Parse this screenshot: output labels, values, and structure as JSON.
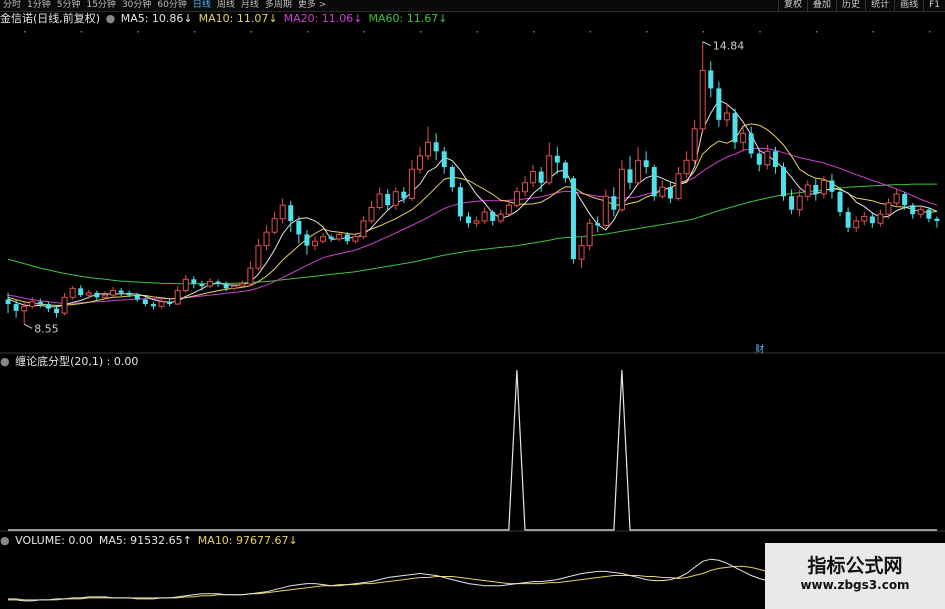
{
  "toolbar": {
    "periods": [
      "分时",
      "1分钟",
      "5分钟",
      "15分钟",
      "30分钟",
      "60分钟",
      "日线",
      "周线",
      "月线",
      "多周期",
      "更多 >"
    ],
    "active_period": "日线",
    "right_buttons": [
      "复权",
      "叠加",
      "历史",
      "统计",
      "画线",
      "F1"
    ]
  },
  "main_panel": {
    "title": "金信诺(日线,前复权)",
    "ma_labels": [
      {
        "text": "MA5: 10.86",
        "arrow": "↓",
        "color": "#e6e6e6"
      },
      {
        "text": "MA10: 11.07",
        "arrow": "↓",
        "color": "#e6d35a"
      },
      {
        "text": "MA20: 11.06",
        "arrow": "↓",
        "color": "#d23ed2"
      },
      {
        "text": "MA60: 11.67",
        "arrow": "↓",
        "color": "#3fc33f"
      }
    ],
    "high_label": "14.84",
    "low_label": "8.55",
    "marker_label": "财"
  },
  "indicator_panel": {
    "title": "缠论底分型(20,1) : 0.00"
  },
  "volume_panel": {
    "labels": [
      {
        "text": "VOLUME: 0.00",
        "arrow": "",
        "color": "#e6e6e6"
      },
      {
        "text": "MA5: 91532.65",
        "arrow": "↑",
        "color": "#e6e6e6"
      },
      {
        "text": "MA10: 97677.67",
        "arrow": "↓",
        "color": "#e6d35a"
      }
    ]
  },
  "watermark": {
    "title": "指标公式网",
    "url": "www.zbgs3.com"
  },
  "colors": {
    "up": "#e05050",
    "down": "#4fe0ea",
    "ma5": "#e6e6e6",
    "ma10": "#e6d35a",
    "ma20": "#d23ed2",
    "ma60": "#3fc33f",
    "signal": "#e6e6e6",
    "separator": "#3a3a3a",
    "period_active": "#5ab4ff"
  },
  "chart_data": {
    "type": "candlestick",
    "price_ylim": [
      8.2,
      15.1
    ],
    "candles": [
      [
        9.1,
        9.0,
        9.25,
        8.8
      ],
      [
        9.0,
        8.85,
        9.1,
        8.7
      ],
      [
        8.85,
        8.95,
        9.05,
        8.55
      ],
      [
        8.95,
        9.05,
        9.15,
        8.9
      ],
      [
        9.05,
        9.0,
        9.12,
        8.92
      ],
      [
        9.0,
        8.9,
        9.05,
        8.82
      ],
      [
        8.9,
        8.8,
        8.98,
        8.7
      ],
      [
        8.8,
        9.15,
        9.25,
        8.75
      ],
      [
        9.15,
        9.35,
        9.4,
        9.1
      ],
      [
        9.35,
        9.2,
        9.42,
        9.15
      ],
      [
        9.2,
        9.25,
        9.32,
        9.12
      ],
      [
        9.25,
        9.15,
        9.3,
        9.08
      ],
      [
        9.15,
        9.2,
        9.28,
        9.1
      ],
      [
        9.2,
        9.3,
        9.38,
        9.15
      ],
      [
        9.3,
        9.25,
        9.36,
        9.18
      ],
      [
        9.25,
        9.2,
        9.3,
        9.15
      ],
      [
        9.2,
        9.1,
        9.25,
        9.05
      ],
      [
        9.1,
        9.0,
        9.15,
        8.95
      ],
      [
        9.0,
        8.95,
        9.05,
        8.88
      ],
      [
        8.95,
        9.05,
        9.1,
        8.9
      ],
      [
        9.05,
        9.0,
        9.12,
        8.95
      ],
      [
        9.0,
        9.3,
        9.4,
        8.98
      ],
      [
        9.3,
        9.55,
        9.65,
        9.25
      ],
      [
        9.55,
        9.45,
        9.62,
        9.35
      ],
      [
        9.45,
        9.4,
        9.52,
        9.3
      ],
      [
        9.4,
        9.5,
        9.58,
        9.35
      ],
      [
        9.5,
        9.45,
        9.55,
        9.38
      ],
      [
        9.45,
        9.35,
        9.5,
        9.28
      ],
      [
        9.35,
        9.4,
        9.48,
        9.3
      ],
      [
        9.4,
        9.45,
        9.52,
        9.35
      ],
      [
        9.45,
        9.8,
        9.95,
        9.4
      ],
      [
        9.8,
        10.3,
        10.45,
        9.75
      ],
      [
        10.3,
        10.6,
        10.75,
        10.2
      ],
      [
        10.6,
        10.9,
        11.05,
        10.55
      ],
      [
        10.9,
        11.2,
        11.35,
        10.8
      ],
      [
        11.2,
        10.85,
        11.3,
        10.6
      ],
      [
        10.85,
        10.55,
        10.95,
        10.35
      ],
      [
        10.55,
        10.3,
        10.65,
        10.1
      ],
      [
        10.3,
        10.4,
        10.5,
        10.2
      ],
      [
        10.4,
        10.5,
        10.58,
        10.35
      ],
      [
        10.5,
        10.45,
        10.55,
        10.38
      ],
      [
        10.45,
        10.55,
        10.62,
        10.4
      ],
      [
        10.55,
        10.4,
        10.6,
        10.32
      ],
      [
        10.4,
        10.5,
        10.58,
        10.35
      ],
      [
        10.5,
        10.85,
        10.95,
        10.45
      ],
      [
        10.85,
        11.15,
        11.3,
        10.8
      ],
      [
        11.15,
        11.45,
        11.6,
        11.1
      ],
      [
        11.45,
        11.2,
        11.55,
        11.1
      ],
      [
        11.2,
        11.5,
        11.6,
        11.1
      ],
      [
        11.5,
        11.35,
        11.6,
        11.25
      ],
      [
        11.35,
        12.0,
        12.2,
        11.3
      ],
      [
        12.0,
        12.3,
        12.5,
        11.9
      ],
      [
        12.3,
        12.6,
        12.95,
        12.2
      ],
      [
        12.6,
        12.4,
        12.8,
        12.2
      ],
      [
        12.4,
        12.05,
        12.5,
        11.9
      ],
      [
        12.05,
        11.6,
        12.1,
        11.5
      ],
      [
        11.6,
        10.95,
        11.7,
        10.85
      ],
      [
        10.95,
        10.8,
        11.05,
        10.7
      ],
      [
        10.8,
        10.85,
        10.95,
        10.72
      ],
      [
        10.85,
        11.05,
        11.15,
        10.78
      ],
      [
        11.05,
        10.85,
        11.1,
        10.75
      ],
      [
        10.85,
        11.0,
        11.1,
        10.8
      ],
      [
        11.0,
        11.2,
        11.3,
        10.95
      ],
      [
        11.2,
        11.5,
        11.6,
        11.15
      ],
      [
        11.5,
        11.7,
        11.85,
        11.4
      ],
      [
        11.7,
        11.95,
        12.1,
        11.6
      ],
      [
        11.95,
        11.7,
        12.05,
        11.5
      ],
      [
        11.7,
        12.3,
        12.6,
        11.65
      ],
      [
        12.3,
        12.15,
        12.5,
        11.9
      ],
      [
        12.15,
        11.8,
        12.2,
        11.7
      ],
      [
        11.8,
        10.0,
        11.85,
        9.9
      ],
      [
        10.0,
        10.3,
        10.5,
        9.8
      ],
      [
        10.3,
        10.8,
        10.9,
        10.2
      ],
      [
        10.8,
        10.75,
        10.95,
        10.6
      ],
      [
        10.75,
        11.4,
        11.55,
        10.7
      ],
      [
        11.4,
        11.1,
        11.6,
        10.95
      ],
      [
        11.1,
        12.0,
        12.2,
        11.05
      ],
      [
        12.0,
        11.7,
        12.3,
        11.55
      ],
      [
        11.7,
        12.2,
        12.5,
        11.65
      ],
      [
        12.2,
        12.05,
        12.4,
        11.9
      ],
      [
        12.05,
        11.4,
        12.1,
        11.3
      ],
      [
        11.4,
        11.6,
        11.75,
        11.35
      ],
      [
        11.6,
        11.35,
        11.7,
        11.25
      ],
      [
        11.35,
        11.9,
        12.05,
        11.3
      ],
      [
        11.9,
        12.2,
        12.4,
        11.8
      ],
      [
        12.2,
        12.9,
        13.1,
        12.1
      ],
      [
        12.9,
        14.2,
        14.84,
        12.8
      ],
      [
        14.2,
        13.8,
        14.4,
        13.6
      ],
      [
        13.8,
        13.1,
        13.95,
        12.95
      ],
      [
        13.1,
        13.25,
        13.45,
        12.95
      ],
      [
        13.25,
        12.6,
        13.35,
        12.45
      ],
      [
        12.6,
        12.8,
        12.95,
        12.4
      ],
      [
        12.8,
        12.35,
        12.95,
        12.25
      ],
      [
        12.35,
        12.1,
        12.45,
        11.95
      ],
      [
        12.1,
        12.4,
        12.55,
        12.0
      ],
      [
        12.4,
        12.05,
        12.5,
        11.9
      ],
      [
        12.05,
        11.4,
        12.15,
        11.3
      ],
      [
        11.4,
        11.1,
        11.55,
        11.0
      ],
      [
        11.1,
        11.4,
        11.55,
        10.95
      ],
      [
        11.4,
        11.65,
        11.75,
        11.3
      ],
      [
        11.65,
        11.45,
        11.8,
        11.3
      ],
      [
        11.45,
        11.75,
        11.85,
        11.35
      ],
      [
        11.75,
        11.5,
        11.9,
        11.35
      ],
      [
        11.5,
        11.05,
        11.6,
        10.95
      ],
      [
        11.05,
        10.7,
        11.15,
        10.6
      ],
      [
        10.7,
        10.85,
        10.95,
        10.6
      ],
      [
        10.85,
        10.95,
        11.05,
        10.75
      ],
      [
        10.95,
        10.8,
        11.05,
        10.7
      ],
      [
        10.8,
        11.0,
        11.1,
        10.72
      ],
      [
        11.0,
        11.25,
        11.35,
        10.9
      ],
      [
        11.25,
        11.45,
        11.55,
        11.15
      ],
      [
        11.45,
        11.2,
        11.5,
        11.1
      ],
      [
        11.2,
        11.0,
        11.25,
        10.9
      ],
      [
        11.0,
        11.1,
        11.2,
        10.92
      ],
      [
        11.1,
        10.9,
        11.15,
        10.82
      ],
      [
        10.9,
        10.85,
        10.95,
        10.7
      ]
    ],
    "ma5_values": [
      9.12,
      9.04,
      8.98,
      8.96,
      8.97,
      8.94,
      8.94,
      8.98,
      9.04,
      9.08,
      9.15,
      9.22,
      9.23,
      9.22,
      9.23,
      9.23,
      9.22,
      9.17,
      9.1,
      9.06,
      9.04,
      9.06,
      9.17,
      9.25,
      9.34,
      9.44,
      9.47,
      9.43,
      9.42,
      9.43,
      9.49,
      9.67,
      9.92,
      10.21,
      10.56,
      10.79,
      10.9,
      10.92,
      10.85,
      10.72,
      10.44,
      10.45,
      10.48,
      10.48,
      10.55,
      10.7,
      10.9,
      11.09,
      11.25,
      11.33,
      11.5,
      11.67,
      11.95,
      12.05,
      12.27,
      12.19,
      11.98,
      11.7,
      11.44,
      11.25,
      11.02,
      10.91,
      10.96,
      11.07,
      11.24,
      11.46,
      11.61,
      11.79,
      11.95,
      11.98,
      11.59,
      11.3,
      11.01,
      10.77,
      10.65,
      10.87,
      11.21,
      11.42,
      11.68,
      11.81,
      11.87,
      11.8,
      11.72,
      11.66,
      11.71,
      12.05,
      12.88,
      13.25,
      13.54,
      13.45,
      13.29,
      13.05,
      12.77,
      12.42,
      12.32,
      12.17,
      12.03,
      11.82,
      11.59,
      11.45,
      11.45,
      11.52,
      11.57,
      11.55,
      11.47,
      11.27,
      11.17,
      11.03,
      10.93,
      10.95,
      11.08,
      11.15,
      11.18,
      11.18,
      11.14,
      11.06
    ],
    "ma10_values": [
      9.15,
      9.1,
      9.05,
      9.02,
      9.0,
      8.98,
      8.97,
      8.97,
      8.99,
      9.01,
      9.04,
      9.08,
      9.12,
      9.15,
      9.16,
      9.18,
      9.19,
      9.19,
      9.16,
      9.14,
      9.12,
      9.12,
      9.14,
      9.18,
      9.22,
      9.26,
      9.3,
      9.33,
      9.35,
      9.37,
      9.41,
      9.5,
      9.62,
      9.78,
      9.98,
      10.14,
      10.3,
      10.45,
      10.57,
      10.67,
      10.62,
      10.6,
      10.57,
      10.55,
      10.6,
      10.67,
      10.74,
      10.82,
      10.9,
      11.0,
      11.1,
      11.25,
      11.42,
      11.6,
      11.78,
      11.82,
      11.8,
      11.75,
      11.65,
      11.55,
      11.44,
      11.31,
      11.28,
      11.23,
      11.22,
      11.23,
      11.27,
      11.37,
      11.5,
      11.61,
      11.6,
      11.48,
      11.4,
      11.34,
      11.29,
      11.21,
      11.2,
      11.24,
      11.28,
      11.38,
      11.44,
      11.55,
      11.58,
      11.69,
      11.75,
      11.96,
      12.34,
      12.51,
      12.63,
      12.58,
      12.67,
      12.96,
      13.01,
      12.98,
      12.88,
      12.73,
      12.54,
      12.29,
      12.0,
      11.88,
      11.8,
      11.78,
      11.69,
      11.57,
      11.46,
      11.36,
      11.33,
      11.3,
      11.24,
      11.21,
      11.17,
      11.16,
      11.1,
      11.06,
      11.04,
      11.06
    ],
    "ma20_values": [
      9.2,
      9.17,
      9.13,
      9.1,
      9.07,
      9.05,
      9.03,
      9.02,
      9.02,
      9.03,
      9.04,
      9.05,
      9.06,
      9.08,
      9.09,
      9.1,
      9.11,
      9.12,
      9.12,
      9.12,
      9.12,
      9.13,
      9.14,
      9.16,
      9.18,
      9.2,
      9.22,
      9.24,
      9.26,
      9.28,
      9.31,
      9.36,
      9.42,
      9.5,
      9.59,
      9.68,
      9.77,
      9.86,
      9.95,
      10.03,
      10.08,
      10.12,
      10.16,
      10.2,
      10.27,
      10.34,
      10.42,
      10.5,
      10.58,
      10.67,
      10.75,
      10.84,
      10.93,
      11.03,
      11.13,
      11.19,
      11.24,
      11.27,
      11.29,
      11.3,
      11.3,
      11.3,
      11.31,
      11.32,
      11.34,
      11.36,
      11.39,
      11.43,
      11.48,
      11.51,
      11.5,
      11.46,
      11.43,
      11.4,
      11.38,
      11.36,
      11.36,
      11.37,
      11.39,
      11.44,
      11.49,
      11.55,
      11.6,
      11.67,
      11.73,
      11.82,
      11.96,
      12.07,
      12.18,
      12.27,
      12.34,
      12.42,
      12.46,
      12.47,
      12.46,
      12.42,
      12.37,
      12.31,
      12.26,
      12.22,
      12.18,
      12.14,
      12.08,
      12.02,
      11.95,
      11.88,
      11.82,
      11.75,
      11.69,
      11.63,
      11.56,
      11.49,
      11.41,
      11.33,
      11.26,
      11.2
    ],
    "ma60_values": [
      10.0,
      9.95,
      9.9,
      9.85,
      9.8,
      9.76,
      9.72,
      9.68,
      9.65,
      9.62,
      9.59,
      9.57,
      9.55,
      9.53,
      9.51,
      9.5,
      9.49,
      9.48,
      9.47,
      9.46,
      9.46,
      9.45,
      9.45,
      9.45,
      9.45,
      9.45,
      9.45,
      9.46,
      9.46,
      9.47,
      9.48,
      9.49,
      9.5,
      9.52,
      9.54,
      9.56,
      9.58,
      9.6,
      9.62,
      9.64,
      9.66,
      9.68,
      9.7,
      9.72,
      9.75,
      9.78,
      9.81,
      9.84,
      9.87,
      9.9,
      9.93,
      9.97,
      10.01,
      10.05,
      10.09,
      10.12,
      10.15,
      10.18,
      10.2,
      10.22,
      10.24,
      10.26,
      10.28,
      10.3,
      10.33,
      10.36,
      10.39,
      10.42,
      10.46,
      10.48,
      10.49,
      10.5,
      10.52,
      10.54,
      10.56,
      10.59,
      10.62,
      10.65,
      10.68,
      10.71,
      10.74,
      10.77,
      10.8,
      10.83,
      10.86,
      10.9,
      10.96,
      11.02,
      11.08,
      11.13,
      11.18,
      11.23,
      11.28,
      11.32,
      11.36,
      11.4,
      11.43,
      11.46,
      11.48,
      11.5,
      11.52,
      11.54,
      11.56,
      11.58,
      11.6,
      11.61,
      11.62,
      11.63,
      11.64,
      11.65,
      11.66,
      11.66,
      11.67,
      11.67,
      11.67,
      11.67
    ],
    "signal": {
      "ylim": [
        0,
        1
      ],
      "peaks_at_index": [
        63,
        76
      ],
      "peak_value": 1
    },
    "volume": {
      "ma5": [
        6,
        6,
        5,
        5,
        6,
        6,
        7,
        7,
        8,
        8,
        9,
        9,
        9,
        8,
        8,
        8,
        7,
        7,
        7,
        8,
        8,
        9,
        10,
        11,
        12,
        12,
        12,
        11,
        11,
        11,
        12,
        13,
        14,
        16,
        18,
        20,
        21,
        22,
        22,
        21,
        20,
        20,
        21,
        22,
        23,
        24,
        26,
        28,
        29,
        30,
        31,
        32,
        31,
        30,
        28,
        26,
        24,
        22,
        21,
        20,
        20,
        20,
        21,
        22,
        23,
        24,
        24,
        25,
        26,
        28,
        30,
        32,
        33,
        34,
        34,
        33,
        32,
        30,
        28,
        26,
        25,
        25,
        26,
        28,
        32,
        38,
        44,
        46,
        45,
        42,
        38,
        34,
        30,
        27,
        25,
        23,
        22,
        22,
        23,
        24,
        24,
        23,
        22,
        21,
        20,
        20,
        21,
        22,
        22,
        21,
        20,
        19,
        18,
        18,
        18,
        19
      ],
      "ma10": [
        7,
        7,
        6,
        6,
        6,
        6,
        6,
        7,
        7,
        7,
        8,
        8,
        8,
        8,
        8,
        8,
        8,
        8,
        8,
        8,
        8,
        8,
        9,
        9,
        10,
        10,
        11,
        11,
        11,
        11,
        12,
        12,
        13,
        14,
        15,
        16,
        17,
        18,
        19,
        20,
        20,
        21,
        21,
        21,
        22,
        22,
        23,
        24,
        25,
        26,
        27,
        28,
        28,
        29,
        29,
        29,
        28,
        27,
        26,
        25,
        24,
        23,
        22,
        22,
        22,
        22,
        22,
        23,
        23,
        24,
        25,
        26,
        27,
        28,
        29,
        30,
        30,
        30,
        30,
        29,
        29,
        28,
        28,
        27,
        28,
        30,
        32,
        35,
        37,
        38,
        39,
        39,
        38,
        36,
        34,
        31,
        29,
        27,
        25,
        24,
        24,
        23,
        23,
        23,
        22,
        22,
        22,
        22,
        22,
        22,
        21,
        21,
        20,
        20,
        19,
        19
      ],
      "ylim": [
        0,
        60
      ]
    }
  }
}
